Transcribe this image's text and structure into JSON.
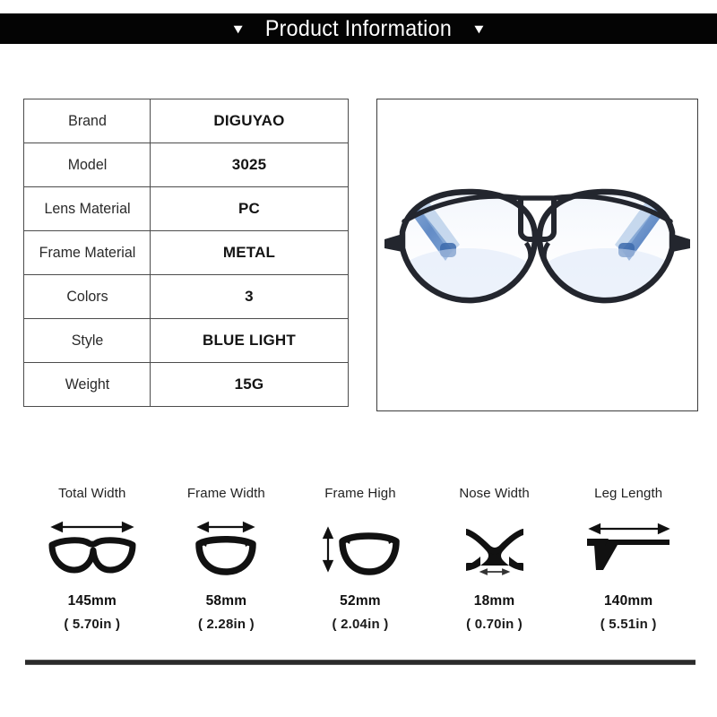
{
  "header": {
    "title": "Product Information",
    "left_marker": "▼",
    "right_marker": "▼"
  },
  "spec_table": {
    "rows": [
      {
        "label": "Brand",
        "value": "DIGUYAO"
      },
      {
        "label": "Model",
        "value": "3025"
      },
      {
        "label": "Lens Material",
        "value": "PC"
      },
      {
        "label": "Frame Material",
        "value": "METAL"
      },
      {
        "label": "Colors",
        "value": "3"
      },
      {
        "label": "Style",
        "value": "BLUE LIGHT"
      },
      {
        "label": "Weight",
        "value": "15G"
      }
    ]
  },
  "product_image": {
    "alt": "aviator eyeglasses front view",
    "frame_color": "#23262e",
    "temple_color": "#5b86c4",
    "lens_tint": "#eef3fb"
  },
  "measurements": [
    {
      "label": "Total Width",
      "mm": "145mm",
      "inch": "( 5.70in )",
      "icon": "full-frame-width-icon"
    },
    {
      "label": "Frame Width",
      "mm": "58mm",
      "inch": "( 2.28in )",
      "icon": "single-lens-width-icon"
    },
    {
      "label": "Frame High",
      "mm": "52mm",
      "inch": "( 2.04in )",
      "icon": "single-lens-height-icon"
    },
    {
      "label": "Nose Width",
      "mm": "18mm",
      "inch": "( 0.70in )",
      "icon": "nose-bridge-icon"
    },
    {
      "label": "Leg Length",
      "mm": "140mm",
      "inch": "( 5.51in )",
      "icon": "temple-arm-icon"
    }
  ],
  "colors": {
    "banner_bg": "#040404",
    "banner_text": "#ffffff",
    "table_border": "#4c4c4c",
    "rule": "#2b2b2b"
  }
}
